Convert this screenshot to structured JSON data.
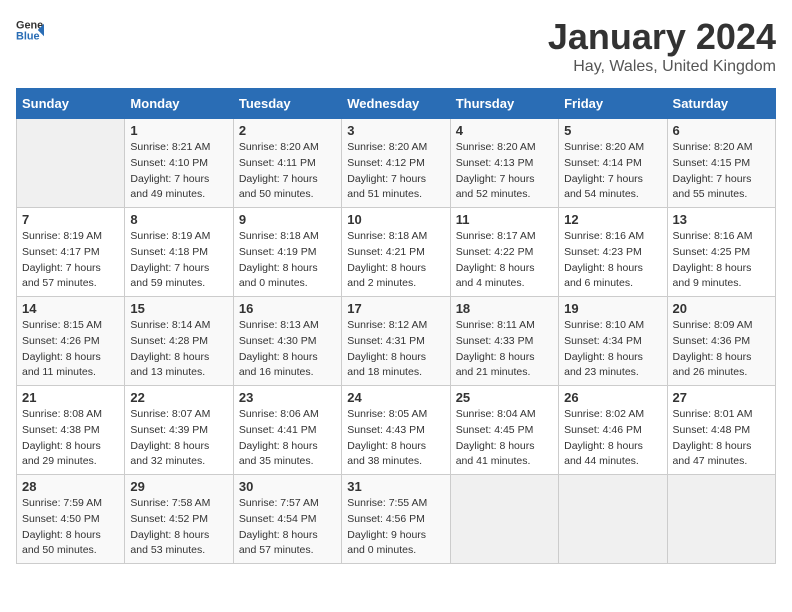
{
  "header": {
    "logo_general": "General",
    "logo_blue": "Blue",
    "title": "January 2024",
    "location": "Hay, Wales, United Kingdom"
  },
  "days_of_week": [
    "Sunday",
    "Monday",
    "Tuesday",
    "Wednesday",
    "Thursday",
    "Friday",
    "Saturday"
  ],
  "weeks": [
    [
      {
        "day": "",
        "sunrise": "",
        "sunset": "",
        "daylight": ""
      },
      {
        "day": "1",
        "sunrise": "Sunrise: 8:21 AM",
        "sunset": "Sunset: 4:10 PM",
        "daylight": "Daylight: 7 hours and 49 minutes."
      },
      {
        "day": "2",
        "sunrise": "Sunrise: 8:20 AM",
        "sunset": "Sunset: 4:11 PM",
        "daylight": "Daylight: 7 hours and 50 minutes."
      },
      {
        "day": "3",
        "sunrise": "Sunrise: 8:20 AM",
        "sunset": "Sunset: 4:12 PM",
        "daylight": "Daylight: 7 hours and 51 minutes."
      },
      {
        "day": "4",
        "sunrise": "Sunrise: 8:20 AM",
        "sunset": "Sunset: 4:13 PM",
        "daylight": "Daylight: 7 hours and 52 minutes."
      },
      {
        "day": "5",
        "sunrise": "Sunrise: 8:20 AM",
        "sunset": "Sunset: 4:14 PM",
        "daylight": "Daylight: 7 hours and 54 minutes."
      },
      {
        "day": "6",
        "sunrise": "Sunrise: 8:20 AM",
        "sunset": "Sunset: 4:15 PM",
        "daylight": "Daylight: 7 hours and 55 minutes."
      }
    ],
    [
      {
        "day": "7",
        "sunrise": "Sunrise: 8:19 AM",
        "sunset": "Sunset: 4:17 PM",
        "daylight": "Daylight: 7 hours and 57 minutes."
      },
      {
        "day": "8",
        "sunrise": "Sunrise: 8:19 AM",
        "sunset": "Sunset: 4:18 PM",
        "daylight": "Daylight: 7 hours and 59 minutes."
      },
      {
        "day": "9",
        "sunrise": "Sunrise: 8:18 AM",
        "sunset": "Sunset: 4:19 PM",
        "daylight": "Daylight: 8 hours and 0 minutes."
      },
      {
        "day": "10",
        "sunrise": "Sunrise: 8:18 AM",
        "sunset": "Sunset: 4:21 PM",
        "daylight": "Daylight: 8 hours and 2 minutes."
      },
      {
        "day": "11",
        "sunrise": "Sunrise: 8:17 AM",
        "sunset": "Sunset: 4:22 PM",
        "daylight": "Daylight: 8 hours and 4 minutes."
      },
      {
        "day": "12",
        "sunrise": "Sunrise: 8:16 AM",
        "sunset": "Sunset: 4:23 PM",
        "daylight": "Daylight: 8 hours and 6 minutes."
      },
      {
        "day": "13",
        "sunrise": "Sunrise: 8:16 AM",
        "sunset": "Sunset: 4:25 PM",
        "daylight": "Daylight: 8 hours and 9 minutes."
      }
    ],
    [
      {
        "day": "14",
        "sunrise": "Sunrise: 8:15 AM",
        "sunset": "Sunset: 4:26 PM",
        "daylight": "Daylight: 8 hours and 11 minutes."
      },
      {
        "day": "15",
        "sunrise": "Sunrise: 8:14 AM",
        "sunset": "Sunset: 4:28 PM",
        "daylight": "Daylight: 8 hours and 13 minutes."
      },
      {
        "day": "16",
        "sunrise": "Sunrise: 8:13 AM",
        "sunset": "Sunset: 4:30 PM",
        "daylight": "Daylight: 8 hours and 16 minutes."
      },
      {
        "day": "17",
        "sunrise": "Sunrise: 8:12 AM",
        "sunset": "Sunset: 4:31 PM",
        "daylight": "Daylight: 8 hours and 18 minutes."
      },
      {
        "day": "18",
        "sunrise": "Sunrise: 8:11 AM",
        "sunset": "Sunset: 4:33 PM",
        "daylight": "Daylight: 8 hours and 21 minutes."
      },
      {
        "day": "19",
        "sunrise": "Sunrise: 8:10 AM",
        "sunset": "Sunset: 4:34 PM",
        "daylight": "Daylight: 8 hours and 23 minutes."
      },
      {
        "day": "20",
        "sunrise": "Sunrise: 8:09 AM",
        "sunset": "Sunset: 4:36 PM",
        "daylight": "Daylight: 8 hours and 26 minutes."
      }
    ],
    [
      {
        "day": "21",
        "sunrise": "Sunrise: 8:08 AM",
        "sunset": "Sunset: 4:38 PM",
        "daylight": "Daylight: 8 hours and 29 minutes."
      },
      {
        "day": "22",
        "sunrise": "Sunrise: 8:07 AM",
        "sunset": "Sunset: 4:39 PM",
        "daylight": "Daylight: 8 hours and 32 minutes."
      },
      {
        "day": "23",
        "sunrise": "Sunrise: 8:06 AM",
        "sunset": "Sunset: 4:41 PM",
        "daylight": "Daylight: 8 hours and 35 minutes."
      },
      {
        "day": "24",
        "sunrise": "Sunrise: 8:05 AM",
        "sunset": "Sunset: 4:43 PM",
        "daylight": "Daylight: 8 hours and 38 minutes."
      },
      {
        "day": "25",
        "sunrise": "Sunrise: 8:04 AM",
        "sunset": "Sunset: 4:45 PM",
        "daylight": "Daylight: 8 hours and 41 minutes."
      },
      {
        "day": "26",
        "sunrise": "Sunrise: 8:02 AM",
        "sunset": "Sunset: 4:46 PM",
        "daylight": "Daylight: 8 hours and 44 minutes."
      },
      {
        "day": "27",
        "sunrise": "Sunrise: 8:01 AM",
        "sunset": "Sunset: 4:48 PM",
        "daylight": "Daylight: 8 hours and 47 minutes."
      }
    ],
    [
      {
        "day": "28",
        "sunrise": "Sunrise: 7:59 AM",
        "sunset": "Sunset: 4:50 PM",
        "daylight": "Daylight: 8 hours and 50 minutes."
      },
      {
        "day": "29",
        "sunrise": "Sunrise: 7:58 AM",
        "sunset": "Sunset: 4:52 PM",
        "daylight": "Daylight: 8 hours and 53 minutes."
      },
      {
        "day": "30",
        "sunrise": "Sunrise: 7:57 AM",
        "sunset": "Sunset: 4:54 PM",
        "daylight": "Daylight: 8 hours and 57 minutes."
      },
      {
        "day": "31",
        "sunrise": "Sunrise: 7:55 AM",
        "sunset": "Sunset: 4:56 PM",
        "daylight": "Daylight: 9 hours and 0 minutes."
      },
      {
        "day": "",
        "sunrise": "",
        "sunset": "",
        "daylight": ""
      },
      {
        "day": "",
        "sunrise": "",
        "sunset": "",
        "daylight": ""
      },
      {
        "day": "",
        "sunrise": "",
        "sunset": "",
        "daylight": ""
      }
    ]
  ]
}
